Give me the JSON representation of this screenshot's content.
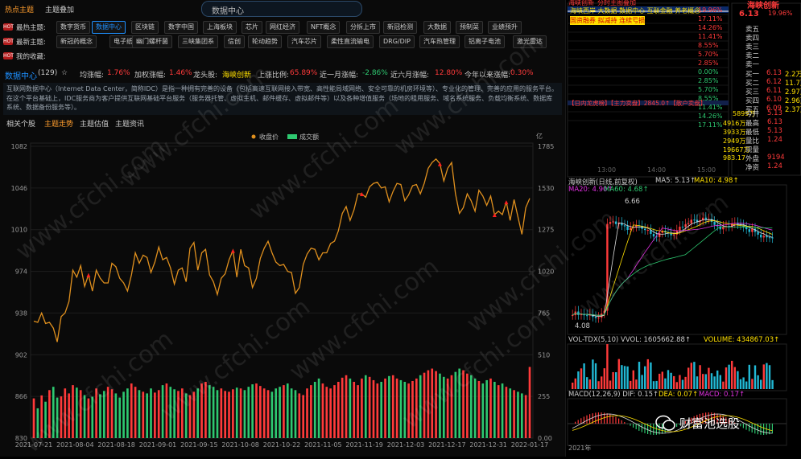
{
  "topbar": {
    "tab_hot": "热点主题",
    "tab_overlay": "主题叠加",
    "search_text": "数据中心"
  },
  "rows": [
    {
      "label": "最热主题:",
      "tags": [
        "数字货币",
        "数据中心",
        "区块链",
        "数字中国",
        "上海板块",
        "芯片",
        "网红经济",
        "NFT概念",
        "分拆上市",
        "新冠检测",
        "大数据",
        "预制菜",
        "业绩预升"
      ]
    },
    {
      "label": "最新主题:",
      "tags": [
        "新冠药概念",
        "电子纸",
        "幽门螺杆菌",
        "三峡集团系",
        "信创",
        "轮动趋势",
        "汽车芯片",
        "柔性直流输电",
        "DRG/DIP",
        "汽车热管理",
        "铝离子电池",
        "激光雷达"
      ]
    },
    {
      "label": "我的收藏:",
      "tags": []
    }
  ],
  "stats": {
    "name": "数据中心",
    "count": "(129)",
    "star": "☆",
    "avg_label": "均涨幅:",
    "avg": "1.76%",
    "wavg_label": "加权涨幅:",
    "wavg": "1.46%",
    "leader_label": "龙头股:",
    "leader": "海峡创新",
    "up_label": "上涨比例:",
    "up": "65.89%",
    "m1_label": "近一月涨幅:",
    "m1": "-2.86%",
    "m6_label": "近六月涨幅:",
    "m6": "12.80%",
    "ytd_label": "今年以来涨幅:",
    "ytd": "0.30%"
  },
  "description": "互联网数据中心（Internet Data Center，简称IDC）是指一种拥有完善的设备（包括高速互联网接入带宽、高性能局域网络、安全可靠的机房环境等）、专业化的管理、完善的应用的服务平台。在这个平台基础上，IDC服务商为客户提供互联网基础平台服务（服务器托管、虚拟主机、邮件缓存、虚拟邮件等）以及各种增值服务（场地的租用服务、域名系统服务、负载均衡系统、数据库系统、数据备份服务等）。",
  "subtabs": [
    "相关个股",
    "主题走势",
    "主题估值",
    "主题资讯"
  ],
  "chart_data": {
    "type": "line",
    "legend": [
      "收盘价",
      "成交额"
    ],
    "price_unit": "亿",
    "y_left_ticks": [
      "1082",
      "1046",
      "1010",
      "974",
      "938",
      "902",
      "866",
      "830"
    ],
    "y_right_ticks": [
      "1785",
      "1530",
      "1275",
      "1020",
      "765",
      "510",
      "255",
      "0.00"
    ],
    "x_ticks": [
      "2021-07-21",
      "2021-08-04",
      "2021-08-18",
      "2021-09-01",
      "2021-09-15",
      "2021-10-08",
      "2021-10-22",
      "2021-11-05",
      "2021-11-19",
      "2021-12-03",
      "2021-12-17",
      "2021-12-31",
      "2022-01-17"
    ],
    "ylim_price": [
      830,
      1082
    ],
    "ylim_volume": [
      0,
      510
    ],
    "close": [
      931,
      930,
      938,
      929,
      930,
      925,
      913,
      935,
      938,
      948,
      975,
      969,
      979,
      961,
      971,
      957,
      975,
      968,
      964,
      964,
      981,
      978,
      968,
      964,
      957,
      971,
      990,
      981,
      988,
      986,
      973,
      982,
      995,
      984,
      986,
      977,
      963,
      975,
      977,
      965,
      994,
      999,
      975,
      990,
      993,
      971,
      965,
      954,
      968,
      972,
      984,
      992,
      969,
      993,
      979,
      977,
      960,
      968,
      985,
      994,
      1000,
      990,
      982,
      979,
      980,
      974,
      973,
      955,
      960,
      980,
      989,
      994,
      993,
      984,
      990,
      990,
      998,
      1000,
      1009,
      1024,
      1030,
      1018,
      1027,
      1041,
      1041,
      1038,
      1047,
      1050,
      1051,
      1046,
      1047,
      1034,
      1043,
      1050,
      1049,
      1035,
      1040,
      1048,
      1049,
      1041,
      1050,
      1063,
      1068,
      1071,
      1067,
      1052,
      1063,
      1068,
      1041,
      1024,
      1029,
      1041,
      1035,
      1026,
      1044,
      1039,
      1031,
      1039,
      1023,
      1026,
      1023,
      1034,
      1018,
      1036,
      1021,
      1006,
      1029,
      1037
    ],
    "volume": [
      240,
      180,
      258,
      220,
      290,
      310,
      245,
      252,
      300,
      270,
      320,
      305,
      290,
      260,
      240,
      250,
      300,
      265,
      285,
      310,
      295,
      270,
      245,
      280,
      300,
      330,
      310,
      290,
      280,
      270,
      300,
      275,
      290,
      320,
      330,
      310,
      295,
      285,
      300,
      270,
      260,
      280,
      300,
      330,
      340,
      320,
      310,
      290,
      300,
      285,
      280,
      295,
      305,
      300,
      290,
      310,
      325,
      330,
      315,
      300,
      290,
      280,
      300,
      310,
      320,
      330,
      300,
      290,
      270,
      260,
      300,
      320,
      340,
      360,
      330,
      310,
      300,
      320,
      340,
      365,
      380,
      360,
      340,
      320,
      360,
      380,
      370,
      350,
      330,
      340,
      360,
      375,
      380,
      360,
      350,
      340,
      330,
      345,
      360,
      380,
      395,
      410,
      420,
      405,
      390,
      370,
      360,
      380,
      400,
      420,
      410,
      390,
      380,
      360,
      345,
      330,
      350,
      360,
      340,
      320,
      330,
      310,
      300,
      290,
      280,
      270,
      260,
      430
    ],
    "signals": [
      14,
      51,
      84,
      104,
      121,
      131,
      132,
      153,
      150,
      134,
      118
    ]
  },
  "right": {
    "quote_title": "海峡创新",
    "quote_tag": "分时主图叠加",
    "price_top": "6.13",
    "pct_top": "19.96%",
    "chg_top": "1.02",
    "concepts1": "海峡西岸 大数据 数据中心 互联金融 养老概念",
    "concepts2": "国资融券 拟减持 连续亏损",
    "pct_scale": [
      "19.96%",
      "17.11%",
      "14.26%",
      "11.41%",
      "8.55%",
      "5.70%",
      "2.85%",
      "0.00%",
      "2.85%",
      "5.70%",
      "8.55%",
      "11.41%",
      "14.26%",
      "17.11%"
    ],
    "sell_labels": [
      "卖五",
      "卖四",
      "卖三",
      "卖二",
      "卖一"
    ],
    "buy_labels": [
      "买一",
      "买二",
      "买三",
      "买四",
      "买五"
    ],
    "buy_prices": [
      "6.13",
      "6.12",
      "6.11",
      "6.10",
      "6.09"
    ],
    "buy_vols": [
      "2.2万",
      "11.7万",
      "2.97万",
      "2.96万",
      "2.37万"
    ],
    "alert": "【日内龙虎榜】【主力卖盘】2845.0↑【散户卖盘】",
    "big_stat": "5899万",
    "info_labels": [
      "今开",
      "最高",
      "最低",
      "量比",
      "现量",
      "外盘",
      "净资"
    ],
    "info_vals": [
      "5.13",
      "6.13",
      "5.13",
      "1.24",
      "",
      "9194",
      "1.24"
    ],
    "info_left": [
      "4916万",
      "3933万",
      "2949万",
      "19667万",
      "983.17"
    ],
    "time_ticks": [
      "13:00",
      "14:00",
      "15:00"
    ],
    "kline_title": "海峡创新(日线,前复权)",
    "ma5": "MA5: 5.13↑",
    "ma10": "MA10: 4.98↑",
    "ma20": "MA20: 4.90↑",
    "ma60": "MA60: 4.68↑",
    "high_mark": "6.66",
    "low_mark": "4.08",
    "vol_title": "VOL-TDX(5,10) VVOL: 1605662.88↑",
    "vol_b": "VOLUME: 434867.03↑",
    "macd_title": "MACD(12,26,9) DIF: 0.15↑",
    "dea": "DEA: 0.07↑",
    "macd": "MACD: 0.17↑",
    "footer_year": "2021年",
    "wechat": "财富池选股"
  },
  "watermark": "www.cfchi.com",
  "colors": {
    "up": "#ff3a3a",
    "down": "#2ec870",
    "price_line": "#e0901e",
    "accent": "#1e90ff"
  }
}
